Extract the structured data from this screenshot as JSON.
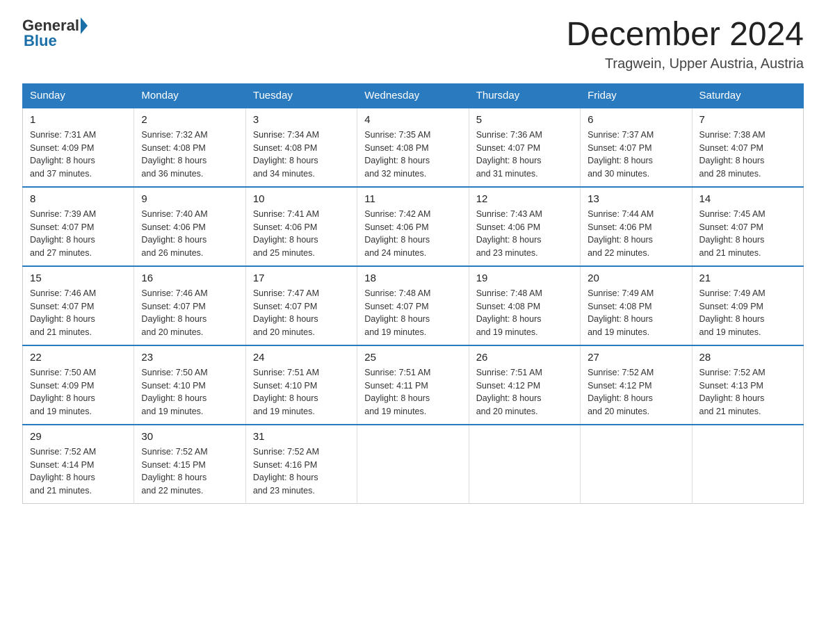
{
  "header": {
    "logo_general": "General",
    "logo_blue": "Blue",
    "month_title": "December 2024",
    "location": "Tragwein, Upper Austria, Austria"
  },
  "weekdays": [
    "Sunday",
    "Monday",
    "Tuesday",
    "Wednesday",
    "Thursday",
    "Friday",
    "Saturday"
  ],
  "weeks": [
    [
      {
        "day": "1",
        "sunrise": "7:31 AM",
        "sunset": "4:09 PM",
        "daylight": "8 hours and 37 minutes."
      },
      {
        "day": "2",
        "sunrise": "7:32 AM",
        "sunset": "4:08 PM",
        "daylight": "8 hours and 36 minutes."
      },
      {
        "day": "3",
        "sunrise": "7:34 AM",
        "sunset": "4:08 PM",
        "daylight": "8 hours and 34 minutes."
      },
      {
        "day": "4",
        "sunrise": "7:35 AM",
        "sunset": "4:08 PM",
        "daylight": "8 hours and 32 minutes."
      },
      {
        "day": "5",
        "sunrise": "7:36 AM",
        "sunset": "4:07 PM",
        "daylight": "8 hours and 31 minutes."
      },
      {
        "day": "6",
        "sunrise": "7:37 AM",
        "sunset": "4:07 PM",
        "daylight": "8 hours and 30 minutes."
      },
      {
        "day": "7",
        "sunrise": "7:38 AM",
        "sunset": "4:07 PM",
        "daylight": "8 hours and 28 minutes."
      }
    ],
    [
      {
        "day": "8",
        "sunrise": "7:39 AM",
        "sunset": "4:07 PM",
        "daylight": "8 hours and 27 minutes."
      },
      {
        "day": "9",
        "sunrise": "7:40 AM",
        "sunset": "4:06 PM",
        "daylight": "8 hours and 26 minutes."
      },
      {
        "day": "10",
        "sunrise": "7:41 AM",
        "sunset": "4:06 PM",
        "daylight": "8 hours and 25 minutes."
      },
      {
        "day": "11",
        "sunrise": "7:42 AM",
        "sunset": "4:06 PM",
        "daylight": "8 hours and 24 minutes."
      },
      {
        "day": "12",
        "sunrise": "7:43 AM",
        "sunset": "4:06 PM",
        "daylight": "8 hours and 23 minutes."
      },
      {
        "day": "13",
        "sunrise": "7:44 AM",
        "sunset": "4:06 PM",
        "daylight": "8 hours and 22 minutes."
      },
      {
        "day": "14",
        "sunrise": "7:45 AM",
        "sunset": "4:07 PM",
        "daylight": "8 hours and 21 minutes."
      }
    ],
    [
      {
        "day": "15",
        "sunrise": "7:46 AM",
        "sunset": "4:07 PM",
        "daylight": "8 hours and 21 minutes."
      },
      {
        "day": "16",
        "sunrise": "7:46 AM",
        "sunset": "4:07 PM",
        "daylight": "8 hours and 20 minutes."
      },
      {
        "day": "17",
        "sunrise": "7:47 AM",
        "sunset": "4:07 PM",
        "daylight": "8 hours and 20 minutes."
      },
      {
        "day": "18",
        "sunrise": "7:48 AM",
        "sunset": "4:07 PM",
        "daylight": "8 hours and 19 minutes."
      },
      {
        "day": "19",
        "sunrise": "7:48 AM",
        "sunset": "4:08 PM",
        "daylight": "8 hours and 19 minutes."
      },
      {
        "day": "20",
        "sunrise": "7:49 AM",
        "sunset": "4:08 PM",
        "daylight": "8 hours and 19 minutes."
      },
      {
        "day": "21",
        "sunrise": "7:49 AM",
        "sunset": "4:09 PM",
        "daylight": "8 hours and 19 minutes."
      }
    ],
    [
      {
        "day": "22",
        "sunrise": "7:50 AM",
        "sunset": "4:09 PM",
        "daylight": "8 hours and 19 minutes."
      },
      {
        "day": "23",
        "sunrise": "7:50 AM",
        "sunset": "4:10 PM",
        "daylight": "8 hours and 19 minutes."
      },
      {
        "day": "24",
        "sunrise": "7:51 AM",
        "sunset": "4:10 PM",
        "daylight": "8 hours and 19 minutes."
      },
      {
        "day": "25",
        "sunrise": "7:51 AM",
        "sunset": "4:11 PM",
        "daylight": "8 hours and 19 minutes."
      },
      {
        "day": "26",
        "sunrise": "7:51 AM",
        "sunset": "4:12 PM",
        "daylight": "8 hours and 20 minutes."
      },
      {
        "day": "27",
        "sunrise": "7:52 AM",
        "sunset": "4:12 PM",
        "daylight": "8 hours and 20 minutes."
      },
      {
        "day": "28",
        "sunrise": "7:52 AM",
        "sunset": "4:13 PM",
        "daylight": "8 hours and 21 minutes."
      }
    ],
    [
      {
        "day": "29",
        "sunrise": "7:52 AM",
        "sunset": "4:14 PM",
        "daylight": "8 hours and 21 minutes."
      },
      {
        "day": "30",
        "sunrise": "7:52 AM",
        "sunset": "4:15 PM",
        "daylight": "8 hours and 22 minutes."
      },
      {
        "day": "31",
        "sunrise": "7:52 AM",
        "sunset": "4:16 PM",
        "daylight": "8 hours and 23 minutes."
      },
      null,
      null,
      null,
      null
    ]
  ],
  "labels": {
    "sunrise": "Sunrise:",
    "sunset": "Sunset:",
    "daylight": "Daylight:"
  }
}
